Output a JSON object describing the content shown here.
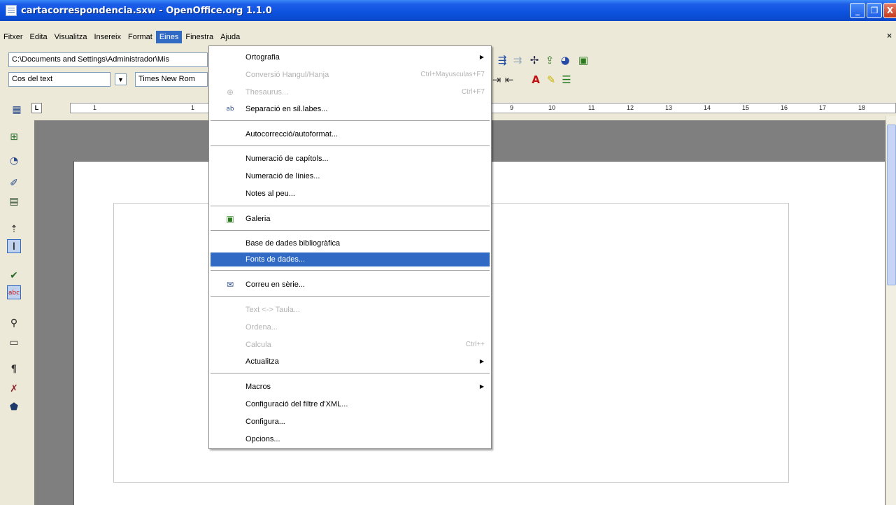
{
  "window": {
    "title": "cartacorrespondencia.sxw - OpenOffice.org 1.1.0",
    "minimize": "_",
    "maximize": "❐",
    "close": "X"
  },
  "menubar": {
    "items": [
      "Fitxer",
      "Edita",
      "Visualitza",
      "Insereix",
      "Format",
      "Eines",
      "Finestra",
      "Ajuda"
    ],
    "active": "Eines",
    "close_glyph": "×"
  },
  "toolbar1": {
    "path_value": "C:\\Documents and Settings\\Administrador\\Mis"
  },
  "toolbar2": {
    "style_value": "Cos del text",
    "font_value": "Times New Rom"
  },
  "ruler": {
    "left_labels": [
      "1",
      "1"
    ],
    "right_labels": [
      "9",
      "10",
      "11",
      "12",
      "13",
      "14",
      "15",
      "16",
      "17",
      "18"
    ]
  },
  "eines_menu": {
    "items": [
      {
        "label": "Ortografia",
        "disabled": false,
        "submenu": true
      },
      {
        "label": "Conversió Hangul/Hanja",
        "disabled": true,
        "shortcut": "Ctrl+Mayusculas+F7"
      },
      {
        "label": "Thesaurus...",
        "disabled": true,
        "shortcut": "Ctrl+F7",
        "icon": "thesaurus-icon"
      },
      {
        "label": "Separació en síl.labes...",
        "disabled": false,
        "icon": "hyphenation-icon"
      },
      {
        "label": "Autocorrecció/autoformat...",
        "disabled": false
      },
      {
        "label": "Numeració de capítols...",
        "disabled": false
      },
      {
        "label": "Numeració de línies...",
        "disabled": false
      },
      {
        "label": "Notes al peu...",
        "disabled": false
      },
      {
        "label": "Galeria",
        "disabled": false,
        "icon": "gallery-icon"
      },
      {
        "label": "Base de dades bibliogràfica",
        "disabled": false
      },
      {
        "label": "Fonts de dades...",
        "disabled": false,
        "highlighted": true
      },
      {
        "label": "Correu en sèrie...",
        "disabled": false,
        "icon": "mail-merge-icon"
      },
      {
        "label": "Text <-> Taula...",
        "disabled": true
      },
      {
        "label": "Ordena...",
        "disabled": true
      },
      {
        "label": "Calcula",
        "disabled": true,
        "shortcut": "Ctrl++"
      },
      {
        "label": "Actualitza",
        "disabled": false,
        "submenu": true
      },
      {
        "label": "Macros",
        "disabled": false,
        "submenu": true
      },
      {
        "label": "Configuració del filtre d'XML...",
        "disabled": false
      },
      {
        "label": "Configura...",
        "disabled": false
      },
      {
        "label": "Opcions...",
        "disabled": false
      }
    ]
  },
  "colors": {
    "titlebar": "#0c52de",
    "highlight": "#316ac5",
    "doc_background": "#7f7f7f",
    "chrome": "#ece9d8"
  }
}
